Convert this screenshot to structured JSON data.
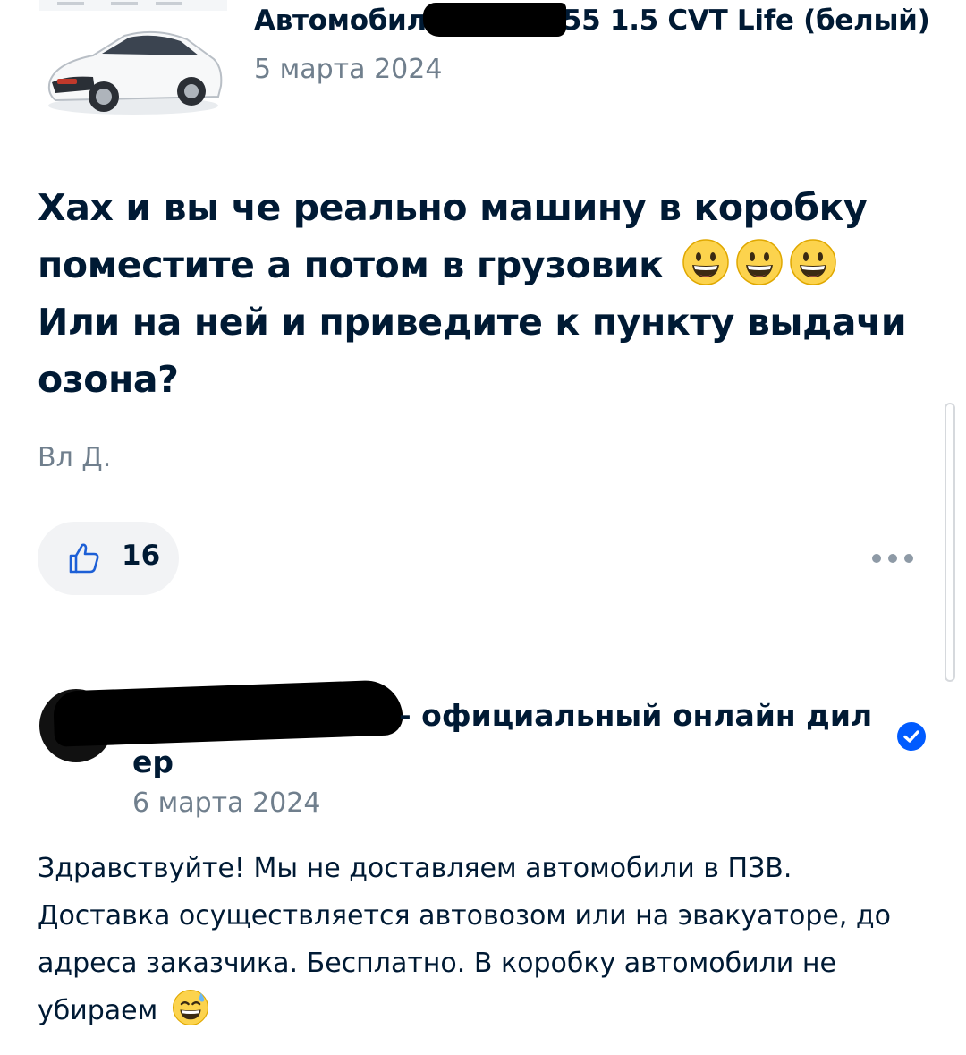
{
  "product": {
    "title_start": "Автомобил",
    "title_end": "55 1.5 CVT Life (белый)",
    "date": "5 марта 2024",
    "thumbnail_icon": "car-thumbnail"
  },
  "review": {
    "lines": [
      "Хах и вы че реально машину в коробку",
      "поместите а потом в грузовик",
      "Или на ней и приведите к пункту выдачи",
      "озона?"
    ],
    "emoji_icons": [
      "grinning-face-emoji",
      "grinning-face-emoji",
      "grinning-face-emoji"
    ],
    "author": "Вл Д.",
    "likes": "16",
    "like_icon": "thumbs-up-icon",
    "more_icon": "more-dots-icon"
  },
  "seller": {
    "name_line1": "- официальный онлайн дил",
    "name_line2": "ер",
    "verified_icon": "verified-check-icon",
    "date": "6 марта 2024",
    "answer_lines": [
      "Здравствуйте! Мы не доставляем автомобили в ПЗВ.",
      "Доставка осуществляется автовозом или на эвакуаторе, до",
      "адреса заказчика. Бесплатно. В коробку автомобили не",
      "убираем"
    ],
    "answer_emoji": "grinning-face-with-sweat-emoji"
  },
  "colors": {
    "text_primary": "#001a34",
    "text_secondary": "#707f8d",
    "pill_background": "#f2f3f5",
    "verified_blue": "#005bff"
  }
}
